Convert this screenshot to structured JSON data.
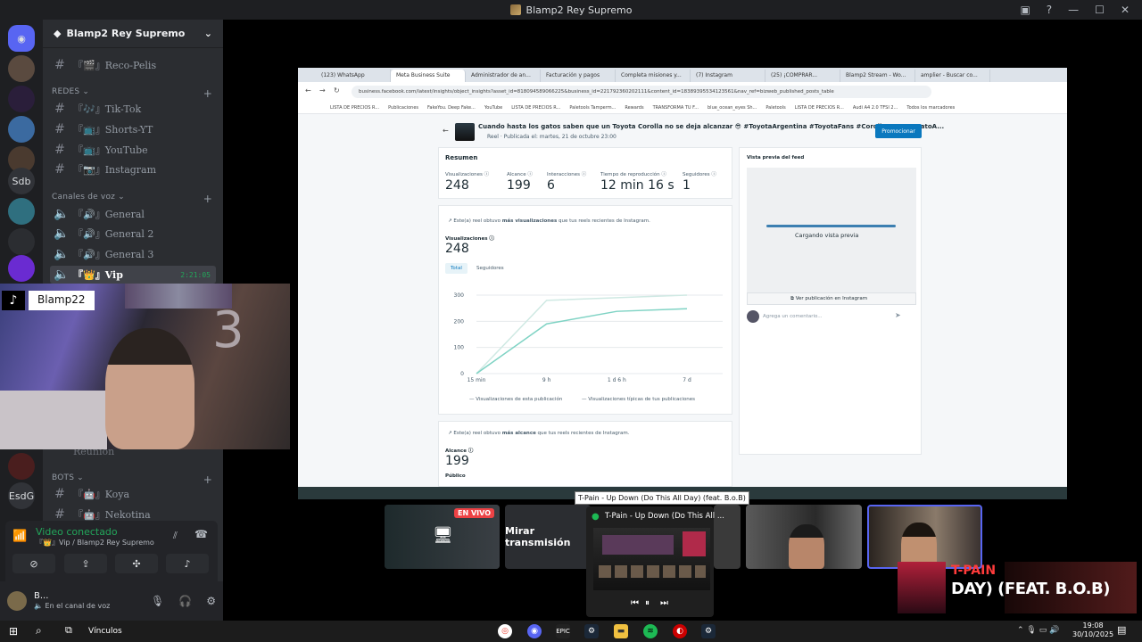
{
  "window": {
    "title": "Blamp2 Rey Supremo"
  },
  "server": {
    "name": "Blamp2 Rey Supremo",
    "rail": [
      "Sdb",
      "EsdG"
    ]
  },
  "channels": {
    "text_top": [
      {
        "label": "『🎬』Reco-Pelis"
      }
    ],
    "category_redes": "REDES",
    "redes": [
      {
        "label": "『🎶』Tik-Tok"
      },
      {
        "label": "『📺』Shorts-YT"
      },
      {
        "label": "『📺』YouTube"
      },
      {
        "label": "『📷』Instagram"
      }
    ],
    "category_voz": "Canales de voz",
    "voz": [
      {
        "label": "『🔊』General"
      },
      {
        "label": "『🔊』General 2"
      },
      {
        "label": "『🔊』General 3"
      },
      {
        "label": "『👑』Vip",
        "time": "2:21:05"
      }
    ],
    "reunion": "Reunion",
    "category_bots": "BOTS",
    "bots": [
      {
        "label": "『🤖』Koya"
      },
      {
        "label": "『🤖』Nekotina"
      }
    ]
  },
  "voice": {
    "status": "Video conectado",
    "location": "『👑』Vip / Blamp2 Rey Supremo"
  },
  "user": {
    "name": "B...",
    "status": "En el canal de voz"
  },
  "cam": {
    "name": "Blamp22"
  },
  "browser": {
    "tabs": [
      "(123) WhatsApp",
      "Meta Business Suite",
      "Administrador de an...",
      "Facturación y pagos",
      "Completa misiones y...",
      "(7) Instagram",
      "(25) ¡COMPRAR...",
      "Blamp2 Stream - Wo...",
      "amplier - Buscar co..."
    ],
    "url": "business.facebook.com/latest/insights/object_insights?asset_id=818094589066225&business_id=221792360202111&content_id=18389395534123561&nav_ref=bizweb_published_posts_table",
    "bookmarks": [
      "LISTA DE PRECIOS R...",
      "Publicaciones",
      "FakeYou. Deep Fake...",
      "YouTube",
      "LISTA DE PRECIOS R...",
      "Paletools Tamperm...",
      "Rewards",
      "TRANSFORMA TU F...",
      "blue_ocean_eyes Sh...",
      "Paletools",
      "LISTA DE PRECIOS R...",
      "Audi A4 2.0 TFSI 2...",
      "Todos los marcadores"
    ],
    "post_title": "Cuando hasta los gatos saben que un Toyota Corolla no se deja alcanzar 😎 #ToyotaArgentina #ToyotaFans #CorollaPower #GatoA...",
    "post_sub": "Reel · Publicada el: martes, 21 de octubre 23:00",
    "promote": "Promocionar",
    "summary_title": "Resumen",
    "metrics": [
      {
        "label": "Visualizaciones ⓘ",
        "value": "248"
      },
      {
        "label": "Alcance ⓘ",
        "value": "199"
      },
      {
        "label": "Interacciones ⓘ",
        "value": "6"
      },
      {
        "label": "Tiempo de reproducción ⓘ",
        "value": "12 min 16 s"
      },
      {
        "label": "Seguidores ⓘ",
        "value": "1"
      }
    ],
    "views_note_pre": "Este(a) reel obtuvo ",
    "views_note_bold": "más visualizaciones",
    "views_note_post": " que tus reels recientes de Instagram.",
    "views_label": "Visualizaciones ⓘ",
    "views_value": "248",
    "seg_total": "Total",
    "seg_followers": "Seguidores",
    "legend_1": "Visualizaciones de esta publicación",
    "legend_2": "Visualizaciones típicas de tus publicaciones",
    "reach_note_pre": "Este(a) reel obtuvo ",
    "reach_note_bold": "más alcance",
    "reach_note_post": " que tus reels recientes de Instagram.",
    "reach_label": "Alcance ⓘ",
    "reach_value": "199",
    "public_label": "Público",
    "feed_title": "Vista previa del feed",
    "loading": "Cargando vista previa",
    "view_ig": "Ver publicación en Instagram",
    "comment_placeholder": "Agrega un comentario..."
  },
  "chart_data": {
    "type": "line",
    "x": [
      "15 min",
      "9 h",
      "1 d 6 h",
      "7 d"
    ],
    "yticks": [
      "0",
      "100",
      "200",
      "300"
    ],
    "ylim": [
      0,
      300
    ],
    "series": [
      {
        "name": "Visualizaciones de esta publicación",
        "color": "#7fd3c4",
        "values": [
          0,
          190,
          238,
          248
        ]
      },
      {
        "name": "Visualizaciones típicas de tus publicaciones",
        "color": "#cfe9e3",
        "values": [
          0,
          280,
          290,
          300
        ]
      }
    ]
  },
  "tiles": {
    "live": "EN VIVO",
    "watch": "Mirar transmisión"
  },
  "spotify": {
    "tooltip": "T-Pain - Up Down (Do This All Day) (feat. B.o.B)",
    "title": "T-Pain - Up Down (Do This All ..."
  },
  "now_playing": {
    "artist": "T-PAIN",
    "song": "DAY) (FEAT. B.O.B)"
  },
  "taskbar": {
    "links": "Vínculos",
    "time": "19:08",
    "date": "30/10/2025"
  }
}
